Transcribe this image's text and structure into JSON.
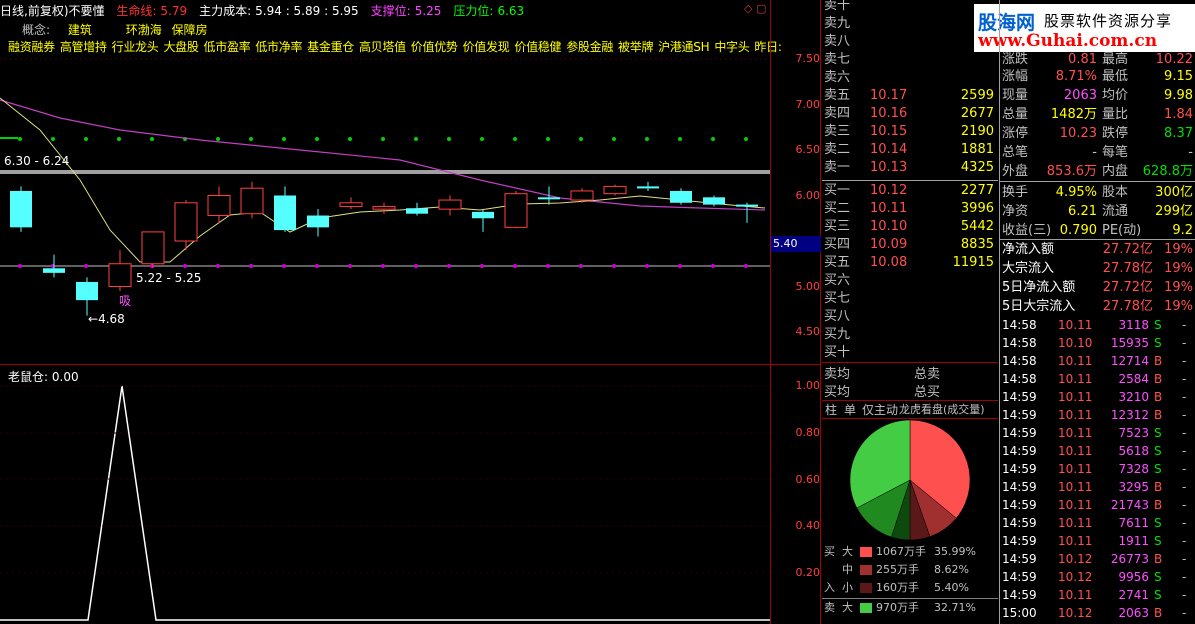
{
  "header": {
    "period_label": "日线,前复权)",
    "indicator_name": "不要懂",
    "items": [
      {
        "label": "生命线:",
        "value": "5.79",
        "color": "#ff3030"
      },
      {
        "label": "主力成本:",
        "value": "5.94 : 5.89 : 5.95",
        "color": "#ffffff"
      },
      {
        "label": "支撑位:",
        "value": "5.25",
        "color": "#ff40ff"
      },
      {
        "label": "压力位:",
        "value": "6.63",
        "color": "#00ff00"
      }
    ]
  },
  "concept": {
    "label": "概念:",
    "items": [
      "建筑",
      "环渤海",
      "保障房"
    ]
  },
  "sectors": [
    "融资融券",
    "高管增持",
    "行业龙头",
    "大盘股",
    "低市盈率",
    "低市净率",
    "基金重仓",
    "高贝塔值",
    "价值优势",
    "价值发现",
    "价值稳健",
    "参股金融",
    "被举牌",
    "沪港通SH",
    "中字头",
    "昨日:"
  ],
  "main_chart": {
    "y_ticks": [
      "7.50",
      "7.00",
      "6.50",
      "6.00",
      "5.50",
      "5.00",
      "4.50"
    ],
    "annotations": {
      "high_range": "6.30 - 6.24",
      "low_range": "5.22 - 5.25",
      "low_price": "4.68",
      "signal": "吸"
    },
    "current_price_tag": "5.40",
    "candles": [
      {
        "o": 6.05,
        "c": 5.65,
        "h": 6.1,
        "l": 5.6
      },
      {
        "o": 5.2,
        "c": 5.15,
        "h": 5.35,
        "l": 5.1
      },
      {
        "o": 5.05,
        "c": 4.85,
        "h": 5.1,
        "l": 4.68
      },
      {
        "o": 5.0,
        "c": 5.25,
        "h": 5.4,
        "l": 4.95
      },
      {
        "o": 5.25,
        "c": 5.6,
        "h": 5.6,
        "l": 5.2
      },
      {
        "o": 5.5,
        "c": 5.92,
        "h": 5.95,
        "l": 5.4
      },
      {
        "o": 5.78,
        "c": 6.0,
        "h": 6.1,
        "l": 5.7
      },
      {
        "o": 5.8,
        "c": 6.08,
        "h": 6.15,
        "l": 5.75
      },
      {
        "o": 6.0,
        "c": 5.62,
        "h": 6.1,
        "l": 5.6
      },
      {
        "o": 5.78,
        "c": 5.65,
        "h": 5.85,
        "l": 5.55
      },
      {
        "o": 5.88,
        "c": 5.92,
        "h": 5.98,
        "l": 5.85
      },
      {
        "o": 5.85,
        "c": 5.88,
        "h": 5.92,
        "l": 5.8
      },
      {
        "o": 5.86,
        "c": 5.8,
        "h": 5.92,
        "l": 5.78
      },
      {
        "o": 5.85,
        "c": 5.95,
        "h": 6.0,
        "l": 5.78
      },
      {
        "o": 5.82,
        "c": 5.75,
        "h": 5.84,
        "l": 5.6
      },
      {
        "o": 5.65,
        "c": 6.02,
        "h": 6.05,
        "l": 5.64
      },
      {
        "o": 5.98,
        "c": 5.96,
        "h": 6.1,
        "l": 5.9
      },
      {
        "o": 5.95,
        "c": 6.05,
        "h": 6.08,
        "l": 5.92
      },
      {
        "o": 6.02,
        "c": 6.1,
        "h": 6.12,
        "l": 6.0
      },
      {
        "o": 6.1,
        "c": 6.08,
        "h": 6.15,
        "l": 6.05
      },
      {
        "o": 6.05,
        "c": 5.92,
        "h": 6.08,
        "l": 5.9
      },
      {
        "o": 5.98,
        "c": 5.9,
        "h": 6.0,
        "l": 5.88
      },
      {
        "o": 5.9,
        "c": 5.88,
        "h": 5.92,
        "l": 5.7
      }
    ]
  },
  "sub_chart": {
    "title": "老鼠仓:",
    "value": "0.00",
    "y_ticks": [
      "1.00",
      "0.80",
      "0.60",
      "0.40",
      "0.20"
    ]
  },
  "order_book": {
    "sell": [
      {
        "label": "卖十",
        "price": "",
        "vol": ""
      },
      {
        "label": "卖九",
        "price": "",
        "vol": ""
      },
      {
        "label": "卖八",
        "price": "",
        "vol": ""
      },
      {
        "label": "卖七",
        "price": "",
        "vol": ""
      },
      {
        "label": "卖六",
        "price": "",
        "vol": ""
      },
      {
        "label": "卖五",
        "price": "10.17",
        "vol": "2599"
      },
      {
        "label": "卖四",
        "price": "10.16",
        "vol": "2677"
      },
      {
        "label": "卖三",
        "price": "10.15",
        "vol": "2190"
      },
      {
        "label": "卖二",
        "price": "10.14",
        "vol": "1881"
      },
      {
        "label": "卖一",
        "price": "10.13",
        "vol": "4325"
      }
    ],
    "buy": [
      {
        "label": "买一",
        "price": "10.12",
        "vol": "2277"
      },
      {
        "label": "买二",
        "price": "10.11",
        "vol": "3996"
      },
      {
        "label": "买三",
        "price": "10.10",
        "vol": "5442"
      },
      {
        "label": "买四",
        "price": "10.09",
        "vol": "8835"
      },
      {
        "label": "买五",
        "price": "10.08",
        "vol": "11915"
      },
      {
        "label": "买六",
        "price": "",
        "vol": ""
      },
      {
        "label": "买七",
        "price": "",
        "vol": ""
      },
      {
        "label": "买八",
        "price": "",
        "vol": ""
      },
      {
        "label": "买九",
        "price": "",
        "vol": ""
      },
      {
        "label": "买十",
        "price": "",
        "vol": ""
      }
    ],
    "avg_sell_label": "卖均",
    "avg_buy_label": "买均",
    "total_sell_label": "总卖",
    "total_buy_label": "总买"
  },
  "tabs": [
    "柱",
    "单",
    "仅主动",
    "龙虎看盘(成交量)"
  ],
  "logo": {
    "brand": "股海网",
    "slogan": "股票软件资源分享",
    "url": "www.Guhai.com.cn"
  },
  "stats": [
    {
      "l1": "涨跌",
      "v1": "0.81",
      "c1": "#ff5050",
      "l2": "最高",
      "v2": "10.22",
      "c2": "#ff5050"
    },
    {
      "l1": "涨幅",
      "v1": "8.71%",
      "c1": "#ff5050",
      "l2": "最低",
      "v2": "9.15",
      "c2": "#ffff00"
    },
    {
      "l1": "现量",
      "v1": "2063",
      "c1": "#ff50ff",
      "l2": "均价",
      "v2": "9.98",
      "c2": "#ffff00"
    },
    {
      "l1": "总量",
      "v1": "1482万",
      "c1": "#ffff00",
      "l2": "量比",
      "v2": "1.84",
      "c2": "#ff5050"
    },
    {
      "l1": "涨停",
      "v1": "10.23",
      "c1": "#ff5050",
      "l2": "跌停",
      "v2": "8.37",
      "c2": "#00e000"
    },
    {
      "l1": "总笔",
      "v1": "-",
      "c1": "#c0c0c0",
      "l2": "每笔",
      "v2": "-",
      "c2": "#c0c0c0"
    },
    {
      "l1": "外盘",
      "v1": "853.6万",
      "c1": "#ff5050",
      "l2": "内盘",
      "v2": "628.8万",
      "c2": "#00e000"
    },
    {
      "l1": "换手",
      "v1": "4.95%",
      "c1": "#ffff00",
      "l2": "股本",
      "v2": "300亿",
      "c2": "#ffff00"
    },
    {
      "l1": "净资",
      "v1": "6.21",
      "c1": "#ffff00",
      "l2": "流通",
      "v2": "299亿",
      "c2": "#ffff00"
    },
    {
      "l1": "收益(三)",
      "v1": "0.790",
      "c1": "#ffff00",
      "l2": "PE(动)",
      "v2": "9.2",
      "c2": "#ffff00"
    }
  ],
  "flows": [
    {
      "label": "净流入额",
      "value": "27.72亿",
      "pct": "19%"
    },
    {
      "label": "大宗流入",
      "value": "27.78亿",
      "pct": "19%"
    },
    {
      "label": "5日净流入额",
      "value": "27.72亿",
      "pct": "19%"
    },
    {
      "label": "5日大宗流入",
      "value": "27.78亿",
      "pct": "19%"
    }
  ],
  "trades": [
    {
      "t": "14:58",
      "p": "10.11",
      "v": "3118",
      "s": "S"
    },
    {
      "t": "14:58",
      "p": "10.10",
      "v": "15935",
      "s": "S"
    },
    {
      "t": "14:58",
      "p": "10.11",
      "v": "12714",
      "s": "B"
    },
    {
      "t": "14:58",
      "p": "10.11",
      "v": "2584",
      "s": "B"
    },
    {
      "t": "14:59",
      "p": "10.11",
      "v": "3210",
      "s": "B"
    },
    {
      "t": "14:59",
      "p": "10.11",
      "v": "12312",
      "s": "B"
    },
    {
      "t": "14:59",
      "p": "10.11",
      "v": "7523",
      "s": "S"
    },
    {
      "t": "14:59",
      "p": "10.11",
      "v": "5618",
      "s": "S"
    },
    {
      "t": "14:59",
      "p": "10.11",
      "v": "7328",
      "s": "S"
    },
    {
      "t": "14:59",
      "p": "10.11",
      "v": "3295",
      "s": "B"
    },
    {
      "t": "14:59",
      "p": "10.11",
      "v": "21743",
      "s": "B"
    },
    {
      "t": "14:59",
      "p": "10.11",
      "v": "7611",
      "s": "S"
    },
    {
      "t": "14:59",
      "p": "10.11",
      "v": "1911",
      "s": "S"
    },
    {
      "t": "14:59",
      "p": "10.12",
      "v": "26773",
      "s": "B"
    },
    {
      "t": "14:59",
      "p": "10.12",
      "v": "9956",
      "s": "S"
    },
    {
      "t": "14:59",
      "p": "10.11",
      "v": "2741",
      "s": "S"
    },
    {
      "t": "15:00",
      "p": "10.12",
      "v": "2063",
      "s": "B"
    }
  ],
  "pie": {
    "slices": [
      {
        "name": "买入大",
        "pct": 35.99,
        "color": "#ff5050"
      },
      {
        "name": "买入中",
        "pct": 8.62,
        "color": "#a03030"
      },
      {
        "name": "买入小",
        "pct": 5.4,
        "color": "#5a1818"
      },
      {
        "name": "卖出小",
        "pct": 5.0,
        "color": "#0e4a0e"
      },
      {
        "name": "卖出中",
        "pct": 12.28,
        "color": "#208a20"
      },
      {
        "name": "卖出大",
        "pct": 32.71,
        "color": "#44cc44"
      }
    ]
  },
  "legend": {
    "buy_label_top": "买",
    "buy_label_bottom": "入",
    "sell_label": "卖",
    "rows": [
      {
        "size": "大",
        "amount": "1067万手",
        "pct": "35.99%",
        "color": "#ff5050"
      },
      {
        "size": "中",
        "amount": "255万手",
        "pct": "8.62%",
        "color": "#a03030"
      },
      {
        "size": "小",
        "amount": "160万手",
        "pct": "5.40%",
        "color": "#5a1818"
      },
      {
        "size": "大",
        "amount": "970万手",
        "pct": "32.71%",
        "color": "#44cc44"
      }
    ]
  }
}
